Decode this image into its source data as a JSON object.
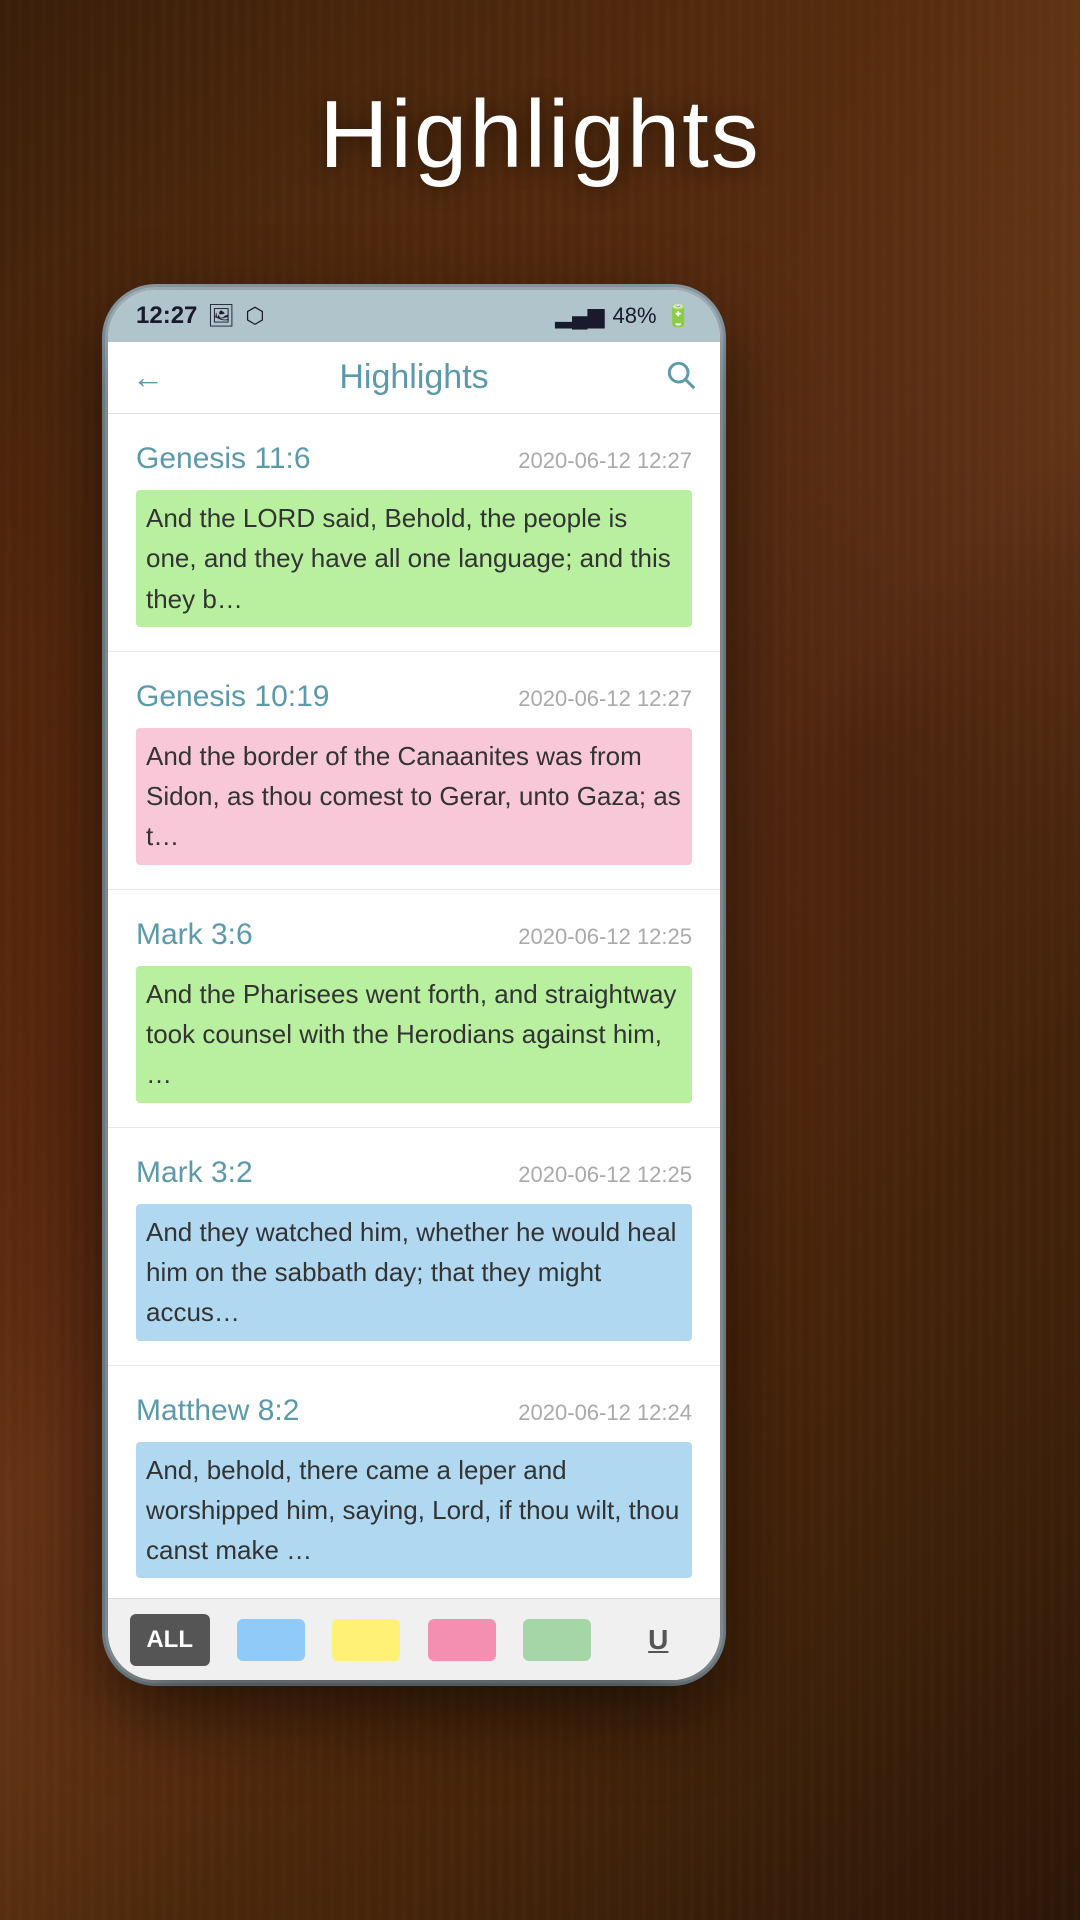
{
  "page": {
    "title": "Highlights",
    "background_description": "wooden table with scrolls and feather quill"
  },
  "status_bar": {
    "time": "12:27",
    "battery": "48%",
    "signal_bars": "▂▄▆",
    "photo_icon": "🖼",
    "bluetooth_icon": "⬡"
  },
  "nav": {
    "back_icon": "←",
    "title": "Highlights",
    "search_icon": "🔍"
  },
  "highlights": [
    {
      "reference": "Genesis 11:6",
      "date": "2020-06-12 12:27",
      "text": "And the LORD said, Behold, the people is one, and they have all one language; and this they b…",
      "highlight_class": "highlight-green"
    },
    {
      "reference": "Genesis 10:19",
      "date": "2020-06-12 12:27",
      "text": "And the border of the Canaanites was from Sidon, as thou comest to Gerar, unto Gaza; as t…",
      "highlight_class": "highlight-pink"
    },
    {
      "reference": "Mark 3:6",
      "date": "2020-06-12 12:25",
      "text": "And the Pharisees went forth, and straightway took counsel with the Herodians against him, …",
      "highlight_class": "highlight-green"
    },
    {
      "reference": "Mark 3:2",
      "date": "2020-06-12 12:25",
      "text": "And they watched him, whether he would heal him on the sabbath day; that they might accus…",
      "highlight_class": "highlight-blue"
    },
    {
      "reference": "Matthew 8:2",
      "date": "2020-06-12 12:24",
      "text": "And, behold, there came a leper and worshipped him, saying, Lord, if thou wilt, thou canst make …",
      "highlight_class": "highlight-blue"
    }
  ],
  "bottom_tabs": {
    "all_label": "ALL",
    "underline_label": "U",
    "colors": [
      "#90caf9",
      "#fff176",
      "#f48fb1",
      "#a5d6a7"
    ]
  }
}
